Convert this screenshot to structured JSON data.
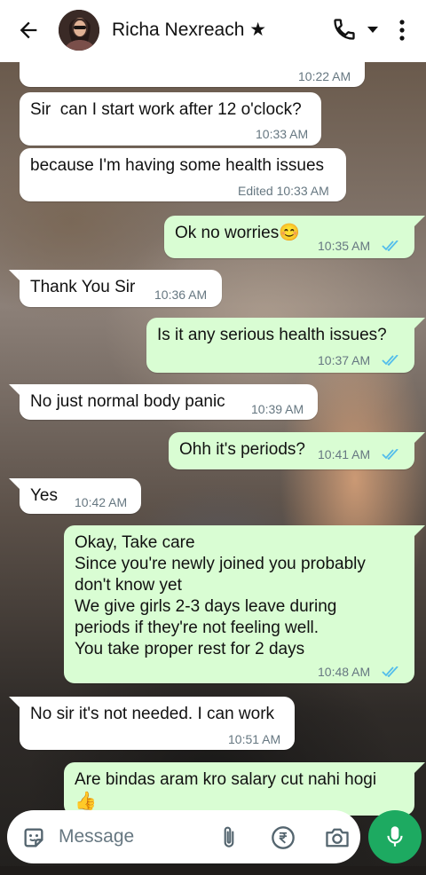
{
  "header": {
    "contact_name": "Richa Nexreach ★",
    "icons": [
      "back-arrow-icon",
      "phone-icon",
      "dropdown-icon",
      "more-vertical-icon"
    ]
  },
  "messages": [
    {
      "dir": "in",
      "text": "",
      "time": "10:22 AM"
    },
    {
      "dir": "in",
      "text": "Sir  can I start work after 12 o'clock?",
      "time": "10:33 AM"
    },
    {
      "dir": "in",
      "text": "because I'm having some health issues",
      "time": "Edited 10:33 AM"
    },
    {
      "dir": "out",
      "text": "Ok no worries😊",
      "time": "10:35 AM",
      "status": "read"
    },
    {
      "dir": "in",
      "text": "Thank You Sir",
      "time": "10:36 AM"
    },
    {
      "dir": "out",
      "text": "Is it any serious health issues?",
      "time": "10:37 AM",
      "status": "read"
    },
    {
      "dir": "in",
      "text": "No just normal body panic",
      "time": "10:39 AM"
    },
    {
      "dir": "out",
      "text": "Ohh it's periods?",
      "time": "10:41 AM",
      "status": "read"
    },
    {
      "dir": "in",
      "text": "Yes",
      "time": "10:42 AM"
    },
    {
      "dir": "out",
      "lines": [
        "Okay, Take care",
        "Since you're newly joined you probably",
        "don't know yet",
        "We give girls 2-3 days leave during",
        "periods if they're not feeling well.",
        "You take proper rest for 2 days"
      ],
      "time": "10:48 AM",
      "status": "read"
    },
    {
      "dir": "in",
      "text": "No sir it's not needed. I can work",
      "time": "10:51 AM"
    },
    {
      "dir": "out",
      "text": "Are bindas aram kro salary cut nahi  hogi",
      "extra": "👍"
    }
  ],
  "composer": {
    "placeholder": "Message",
    "icons": [
      "sticker-icon",
      "attach-icon",
      "rupee-payment-icon",
      "camera-icon",
      "mic-icon"
    ]
  },
  "colors": {
    "incoming": "#ffffff",
    "outgoing": "#d9fdd3",
    "mic_button": "#1daa61",
    "read_ticks": "#53bdeb"
  }
}
